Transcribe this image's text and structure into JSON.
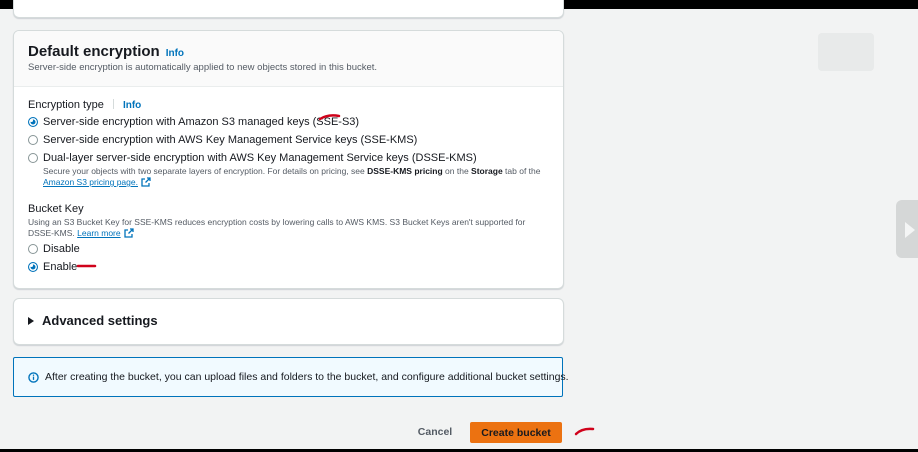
{
  "panel": {
    "title": "Default encryption",
    "title_info": "Info",
    "description": "Server-side encryption is automatically applied to new objects stored in this bucket."
  },
  "encryption_type": {
    "label": "Encryption type",
    "info": "Info",
    "selected": "SSE-S3",
    "options": [
      {
        "label": "Server-side encryption with Amazon S3 managed keys (SSE-S3)",
        "checked": true
      },
      {
        "label": "Server-side encryption with AWS Key Management Service keys (SSE-KMS)",
        "checked": false
      },
      {
        "label": "Dual-layer server-side encryption with AWS Key Management Service keys (DSSE-KMS)",
        "checked": false
      }
    ],
    "dsse_help": {
      "prefix": "Secure your objects with two separate layers of encryption. For details on pricing, see ",
      "bold1": "DSSE-KMS pricing",
      "middle": " on the ",
      "bold2": "Storage",
      "suffix": " tab of the",
      "link": "Amazon S3 pricing page."
    }
  },
  "bucket_key": {
    "label": "Bucket Key",
    "help": "Using an S3 Bucket Key for SSE-KMS reduces encryption costs by lowering calls to AWS KMS. S3 Bucket Keys aren't supported for DSSE-KMS.",
    "learn_more": "Learn more",
    "options": [
      {
        "label": "Disable",
        "checked": false
      },
      {
        "label": "Enable",
        "checked": true
      }
    ]
  },
  "advanced": {
    "label": "Advanced settings"
  },
  "alert": {
    "text": "After creating the bucket, you can upload files and folders to the bucket, and configure additional bucket settings."
  },
  "actions": {
    "cancel": "Cancel",
    "create": "Create bucket"
  },
  "colors": {
    "primary_button": "#ec7211",
    "link": "#0073bb",
    "annotation_mark": "#d0021b"
  },
  "icons": [
    "external-link-icon",
    "info-circle-icon",
    "caret-right-icon",
    "chevron-right-icon"
  ]
}
